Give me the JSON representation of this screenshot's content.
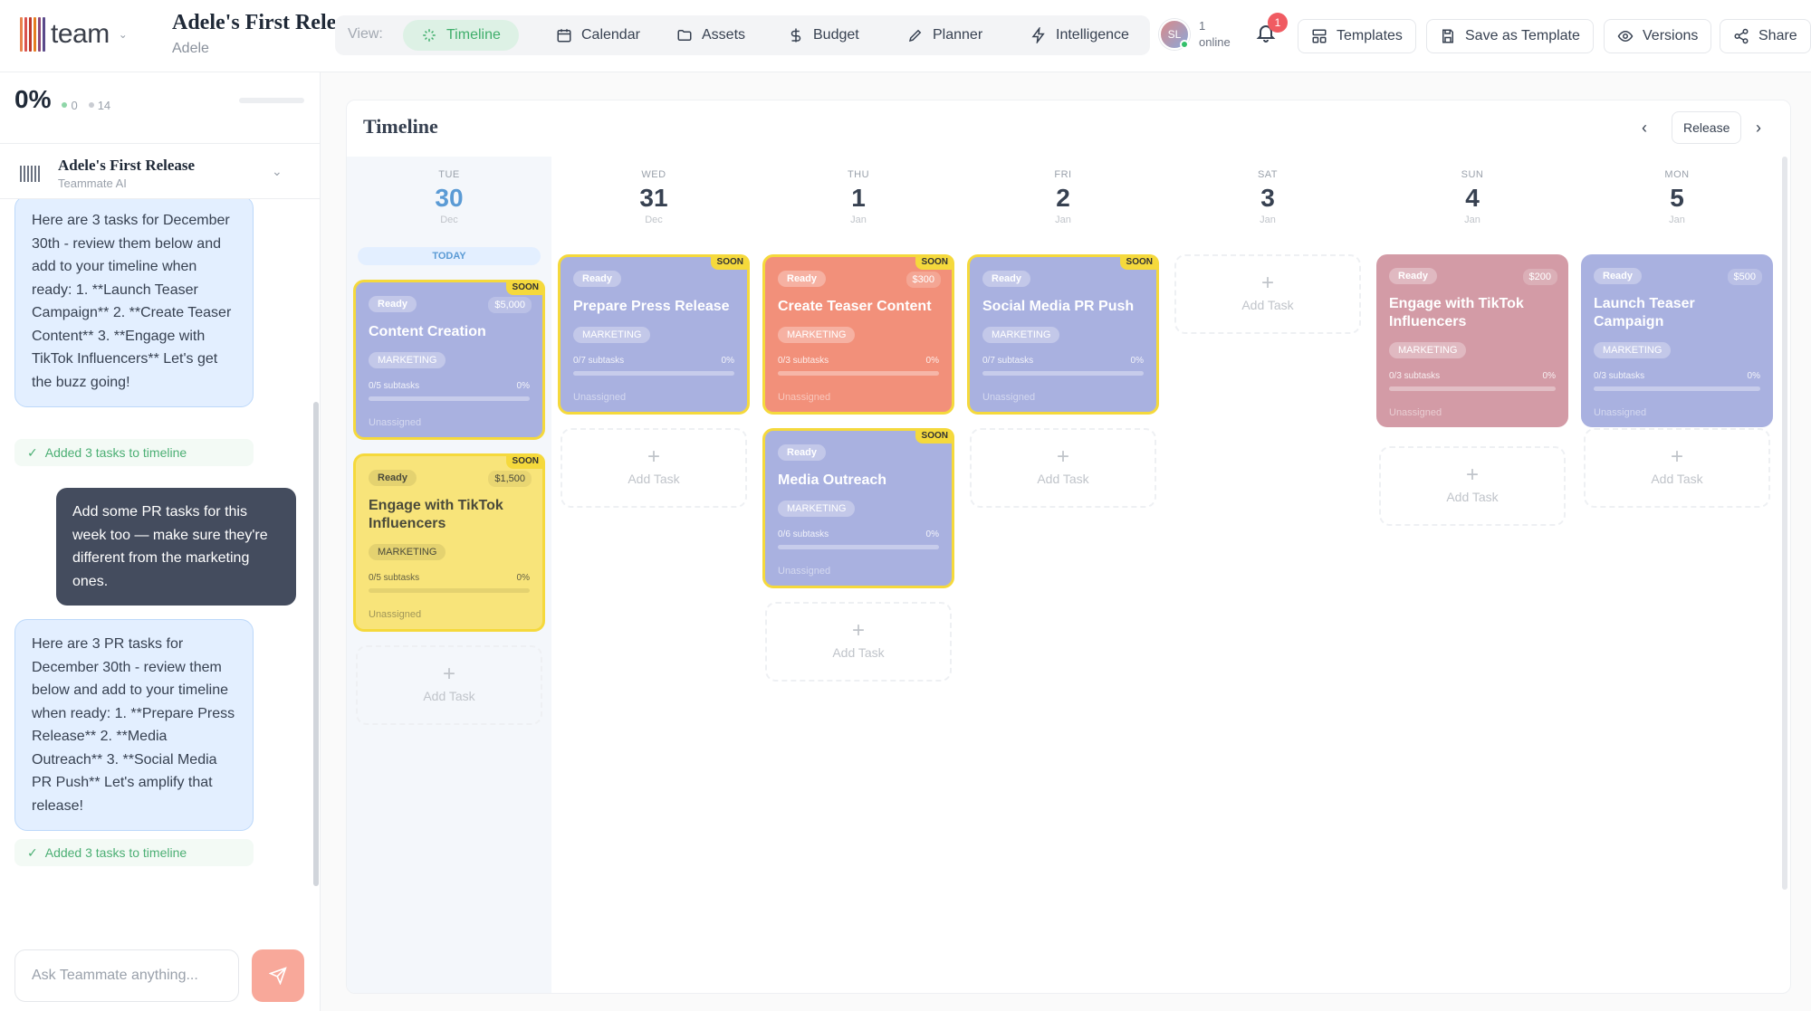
{
  "header": {
    "logo_text": "team",
    "project_title": "Adele's First Rele...",
    "project_subtitle": "Adele",
    "view_label": "View:",
    "nav": [
      {
        "label": "Timeline",
        "icon": "sparkle-icon"
      },
      {
        "label": "Calendar",
        "icon": "calendar-icon"
      },
      {
        "label": "Assets",
        "icon": "folder-icon"
      },
      {
        "label": "Budget",
        "icon": "dollar-icon"
      },
      {
        "label": "Planner",
        "icon": "pencil-icon"
      },
      {
        "label": "Intelligence",
        "icon": "bolt-icon"
      }
    ],
    "active_nav": "Timeline",
    "avatar_initials": "SL",
    "online_count": "1",
    "online_label": "online",
    "notifications": "1",
    "templates_label": "Templates",
    "save_template_label": "Save as Template",
    "versions_label": "Versions",
    "share_label": "Share"
  },
  "sidebar": {
    "progress_pct": "0%",
    "done_count": "0",
    "total_count": "14",
    "assistant_title": "Adele's First Release",
    "assistant_subtitle": "Teammate AI",
    "messages": [
      {
        "role": "ai",
        "text": "Here are 3 tasks for December 30th - review them below and add to your timeline when ready: 1. **Launch Teaser Campaign** 2. **Create Teaser Content** 3. **Engage with TikTok Influencers** Let's get the buzz going!"
      },
      {
        "role": "status",
        "text": "Added 3 tasks to timeline"
      },
      {
        "role": "user",
        "text": "Add some PR tasks for this week too — make sure they're different from the marketing ones."
      },
      {
        "role": "ai",
        "text": "Here are 3 PR tasks for December 30th - review them below and add to your timeline when ready: 1. **Prepare Press Release** 2. **Media Outreach** 3. **Social Media PR Push** Let's amplify that release!"
      },
      {
        "role": "status",
        "text": "Added 3 tasks to timeline"
      }
    ],
    "input_placeholder": "Ask Teammate anything..."
  },
  "timeline": {
    "title": "Timeline",
    "release_label": "Release",
    "today_label": "TODAY",
    "add_task_label": "Add Task",
    "days": [
      {
        "dow": "TUE",
        "num": "30",
        "mon": "Dec",
        "today": true
      },
      {
        "dow": "WED",
        "num": "31",
        "mon": "Dec"
      },
      {
        "dow": "THU",
        "num": "1",
        "mon": "Jan"
      },
      {
        "dow": "FRI",
        "num": "2",
        "mon": "Jan"
      },
      {
        "dow": "SAT",
        "num": "3",
        "mon": "Jan"
      },
      {
        "dow": "SUN",
        "num": "4",
        "mon": "Jan"
      },
      {
        "dow": "MON",
        "num": "5",
        "mon": "Jan"
      }
    ],
    "cards": [
      {
        "day": 0,
        "title": "Content Creation",
        "status": "Ready",
        "budget": "$5,000",
        "soon": true,
        "tag": "MARKETING",
        "subtasks": "0/5 subtasks",
        "pct": "0%",
        "assignee": "Unassigned",
        "color": "#a9b1e0"
      },
      {
        "day": 0,
        "title": "Engage with TikTok Influencers",
        "status": "Ready",
        "budget": "$1,500",
        "soon": true,
        "tag": "MARKETING",
        "subtasks": "0/5 subtasks",
        "pct": "0%",
        "assignee": "Unassigned",
        "color": "#f8e47a"
      },
      {
        "day": 1,
        "title": "Prepare Press Release",
        "status": "Ready",
        "budget": "",
        "soon": true,
        "tag": "MARKETING",
        "subtasks": "0/7 subtasks",
        "pct": "0%",
        "assignee": "Unassigned",
        "color": "#a9b1e0"
      },
      {
        "day": 2,
        "title": "Create Teaser Content",
        "status": "Ready",
        "budget": "$300",
        "soon": true,
        "tag": "MARKETING",
        "subtasks": "0/3 subtasks",
        "pct": "0%",
        "assignee": "Unassigned",
        "color": "#f2907a"
      },
      {
        "day": 2,
        "title": "Media Outreach",
        "status": "Ready",
        "budget": "",
        "soon": true,
        "tag": "MARKETING",
        "subtasks": "0/6 subtasks",
        "pct": "0%",
        "assignee": "Unassigned",
        "color": "#a9b1e0"
      },
      {
        "day": 3,
        "title": "Social Media PR Push",
        "status": "Ready",
        "budget": "",
        "soon": true,
        "tag": "MARKETING",
        "subtasks": "0/7 subtasks",
        "pct": "0%",
        "assignee": "Unassigned",
        "color": "#a9b1e0"
      },
      {
        "day": 5,
        "title": "Engage with TikTok Influencers",
        "status": "Ready",
        "budget": "$200",
        "soon": false,
        "tag": "MARKETING",
        "subtasks": "0/3 subtasks",
        "pct": "0%",
        "assignee": "Unassigned",
        "color": "#d39ba6"
      },
      {
        "day": 6,
        "title": "Launch Teaser Campaign",
        "status": "Ready",
        "budget": "$500",
        "soon": false,
        "tag": "MARKETING",
        "subtasks": "0/3 subtasks",
        "pct": "0%",
        "assignee": "Unassigned",
        "color": "#a9b1e0"
      }
    ],
    "soon_label": "SOON"
  }
}
